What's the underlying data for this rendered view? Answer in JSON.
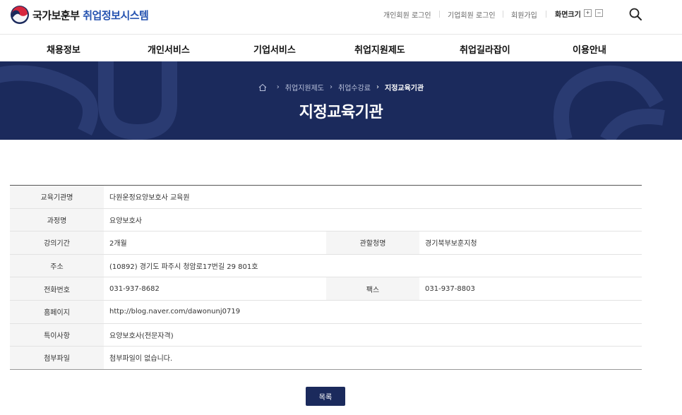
{
  "header": {
    "logo_text_main": "국가보훈부",
    "logo_text_sub": "취업정보시스템",
    "util_links": [
      "개인회원 로그인",
      "기업회원 로그인",
      "회원가입"
    ],
    "font_size_label": "화면크기",
    "font_plus": "+",
    "font_minus": "−"
  },
  "nav": {
    "items": [
      "채용정보",
      "개인서비스",
      "기업서비스",
      "취업지원제도",
      "취업길라잡이",
      "이용안내"
    ]
  },
  "banner": {
    "breadcrumb": [
      "취업지원제도",
      "취업수강료",
      "지정교육기관"
    ],
    "title": "지정교육기관"
  },
  "detail": {
    "institution_label": "교육기관명",
    "institution_value": "다원운정요양보호사 교육원",
    "course_label": "과정명",
    "course_value": "요양보호사",
    "period_label": "강의기간",
    "period_value": "2개월",
    "office_label": "관할청명",
    "office_value": "경기북부보훈지청",
    "address_label": "주소",
    "address_value": "(10892) 경기도 파주시 청암로17번길 29 801호",
    "phone_label": "전화번호",
    "phone_value": "031-937-8682",
    "fax_label": "팩스",
    "fax_value": "031-937-8803",
    "homepage_label": "홈페이지",
    "homepage_value": "http://blog.naver.com/dawonunj0719",
    "notes_label": "특이사항",
    "notes_value": "요양보호사(전문자격)",
    "attachment_label": "첨부파일",
    "attachment_value": "첨부파일이 없습니다."
  },
  "list_button": "목록",
  "colors": {
    "brand_navy": "#1b2a5c",
    "brand_blue": "#2553b0",
    "logo_red": "#d7263d"
  }
}
